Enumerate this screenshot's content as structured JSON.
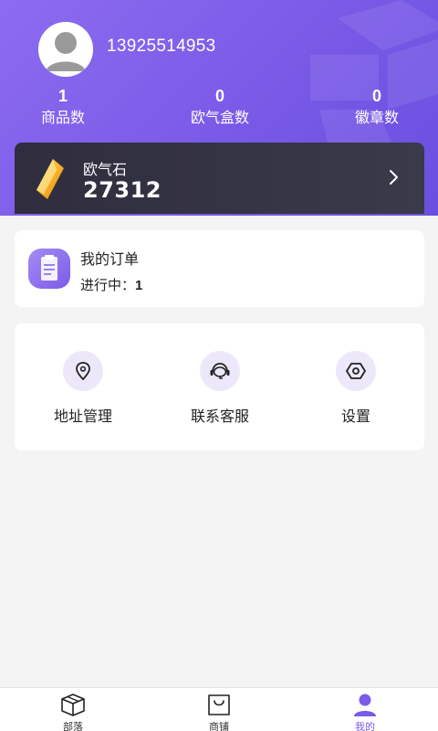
{
  "user": {
    "phone": "13925514953"
  },
  "stats": [
    {
      "value": "1",
      "label": "商品数"
    },
    {
      "value": "0",
      "label": "欧气盒数"
    },
    {
      "value": "0",
      "label": "徽章数"
    }
  ],
  "stone": {
    "label": "欧气石",
    "value": "27312"
  },
  "order": {
    "title": "我的订单",
    "status_label": "进行中：",
    "status_value": "1"
  },
  "menu": [
    {
      "label": "地址管理",
      "icon": "location-pin-icon"
    },
    {
      "label": "联系客服",
      "icon": "headset-icon"
    },
    {
      "label": "设置",
      "icon": "settings-hexagon-icon"
    }
  ],
  "tabs": [
    {
      "label": "部落",
      "icon": "box-icon"
    },
    {
      "label": "商铺",
      "icon": "shopping-bag-icon"
    },
    {
      "label": "我的",
      "icon": "person-icon",
      "active": true
    }
  ],
  "colors": {
    "accent": "#7b5be8",
    "header_start": "#8d6cf0",
    "card_dark": "#2f2d3e"
  }
}
